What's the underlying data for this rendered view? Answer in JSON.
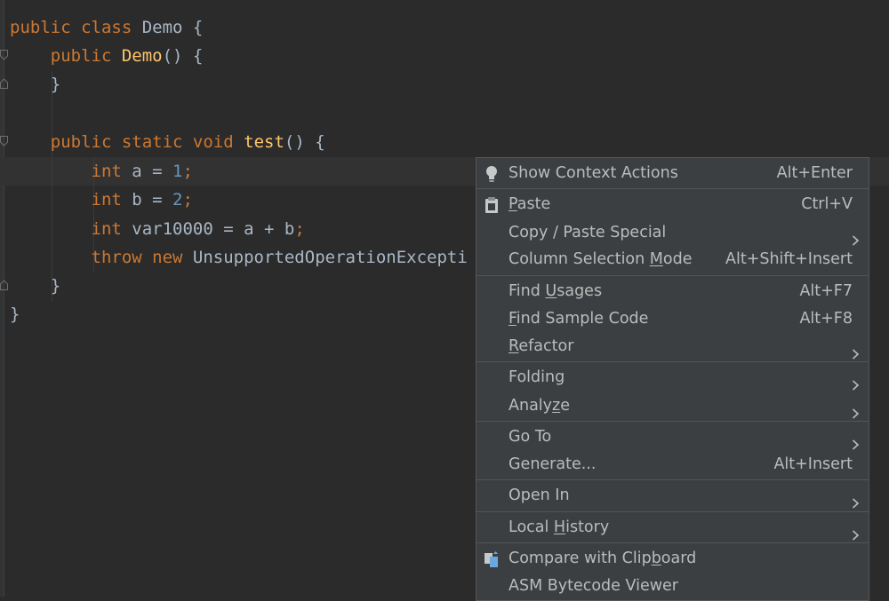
{
  "code": {
    "lines": [
      {
        "parts": [
          [
            "kw",
            "public "
          ],
          [
            "kw",
            "class "
          ],
          [
            "cls",
            "Demo "
          ],
          [
            "cls",
            "{"
          ]
        ]
      },
      {
        "parts": [
          [
            "pad",
            "    "
          ],
          [
            "kw",
            "public "
          ],
          [
            "fn",
            "Demo"
          ],
          [
            "cls",
            "() {"
          ]
        ]
      },
      {
        "parts": [
          [
            "pad",
            "    "
          ],
          [
            "cls",
            "}"
          ]
        ]
      },
      {
        "parts": []
      },
      {
        "parts": [
          [
            "pad",
            "    "
          ],
          [
            "kw",
            "public "
          ],
          [
            "kw",
            "static "
          ],
          [
            "kw",
            "void "
          ],
          [
            "fn",
            "test"
          ],
          [
            "cls",
            "() {"
          ]
        ]
      },
      {
        "parts": [
          [
            "pad",
            "        "
          ],
          [
            "kw",
            "int "
          ],
          [
            "cls",
            "a = "
          ],
          [
            "num",
            "1"
          ],
          [
            "kw",
            ";"
          ]
        ]
      },
      {
        "parts": [
          [
            "pad",
            "        "
          ],
          [
            "kw",
            "int "
          ],
          [
            "cls",
            "b = "
          ],
          [
            "num",
            "2"
          ],
          [
            "kw",
            ";"
          ]
        ]
      },
      {
        "parts": [
          [
            "pad",
            "        "
          ],
          [
            "kw",
            "int "
          ],
          [
            "cls",
            "var10000 = a + b"
          ],
          [
            "kw",
            ";"
          ]
        ]
      },
      {
        "parts": [
          [
            "pad",
            "        "
          ],
          [
            "kw",
            "throw "
          ],
          [
            "kw",
            "new "
          ],
          [
            "cls",
            "UnsupportedOperationExcepti"
          ]
        ]
      },
      {
        "parts": [
          [
            "pad",
            "    "
          ],
          [
            "cls",
            "}"
          ]
        ]
      },
      {
        "parts": [
          [
            "cls",
            "}"
          ]
        ]
      }
    ]
  },
  "menu": {
    "items": [
      {
        "label": "Show Context Actions",
        "shortcut": "Alt+Enter",
        "icon": "lightbulb-icon",
        "name": "show-context-actions"
      },
      {
        "label": "Paste",
        "mnemonic": "P",
        "shortcut": "Ctrl+V",
        "icon": "clipboard-icon",
        "name": "paste"
      },
      {
        "label": "Copy / Paste Special",
        "submenu": true,
        "name": "copy-paste-special"
      },
      {
        "label": "Column Selection Mode",
        "mnemonic": "M",
        "shortcut": "Alt+Shift+Insert",
        "name": "column-selection-mode"
      },
      {
        "label": "Find Usages",
        "mnemonic": "U",
        "shortcut": "Alt+F7",
        "name": "find-usages"
      },
      {
        "label": "Find Sample Code",
        "mnemonic": "F",
        "shortcut": "Alt+F8",
        "name": "find-sample-code"
      },
      {
        "label": "Refactor",
        "mnemonic": "R",
        "submenu": true,
        "name": "refactor"
      },
      {
        "label": "Folding",
        "submenu": true,
        "name": "folding"
      },
      {
        "label": "Analyze",
        "mnemonic": "z",
        "submenu": true,
        "name": "analyze"
      },
      {
        "label": "Go To",
        "submenu": true,
        "name": "go-to"
      },
      {
        "label": "Generate...",
        "shortcut": "Alt+Insert",
        "name": "generate"
      },
      {
        "label": "Open In",
        "submenu": true,
        "name": "open-in"
      },
      {
        "label": "Local History",
        "mnemonic": "H",
        "submenu": true,
        "name": "local-history"
      },
      {
        "label": "Compare with Clipboard",
        "mnemonic": "b",
        "icon": "compare-icon",
        "name": "compare-with-clipboard"
      },
      {
        "label": "ASM Bytecode Viewer",
        "name": "asm-bytecode-viewer"
      }
    ]
  },
  "colors": {
    "background": "#2b2b2b",
    "keyword": "#cc7832",
    "function": "#ffc66d",
    "number": "#6897bb",
    "text": "#a9b7c6",
    "menu_bg": "#3c3f41",
    "menu_text": "#bbbbbb"
  }
}
